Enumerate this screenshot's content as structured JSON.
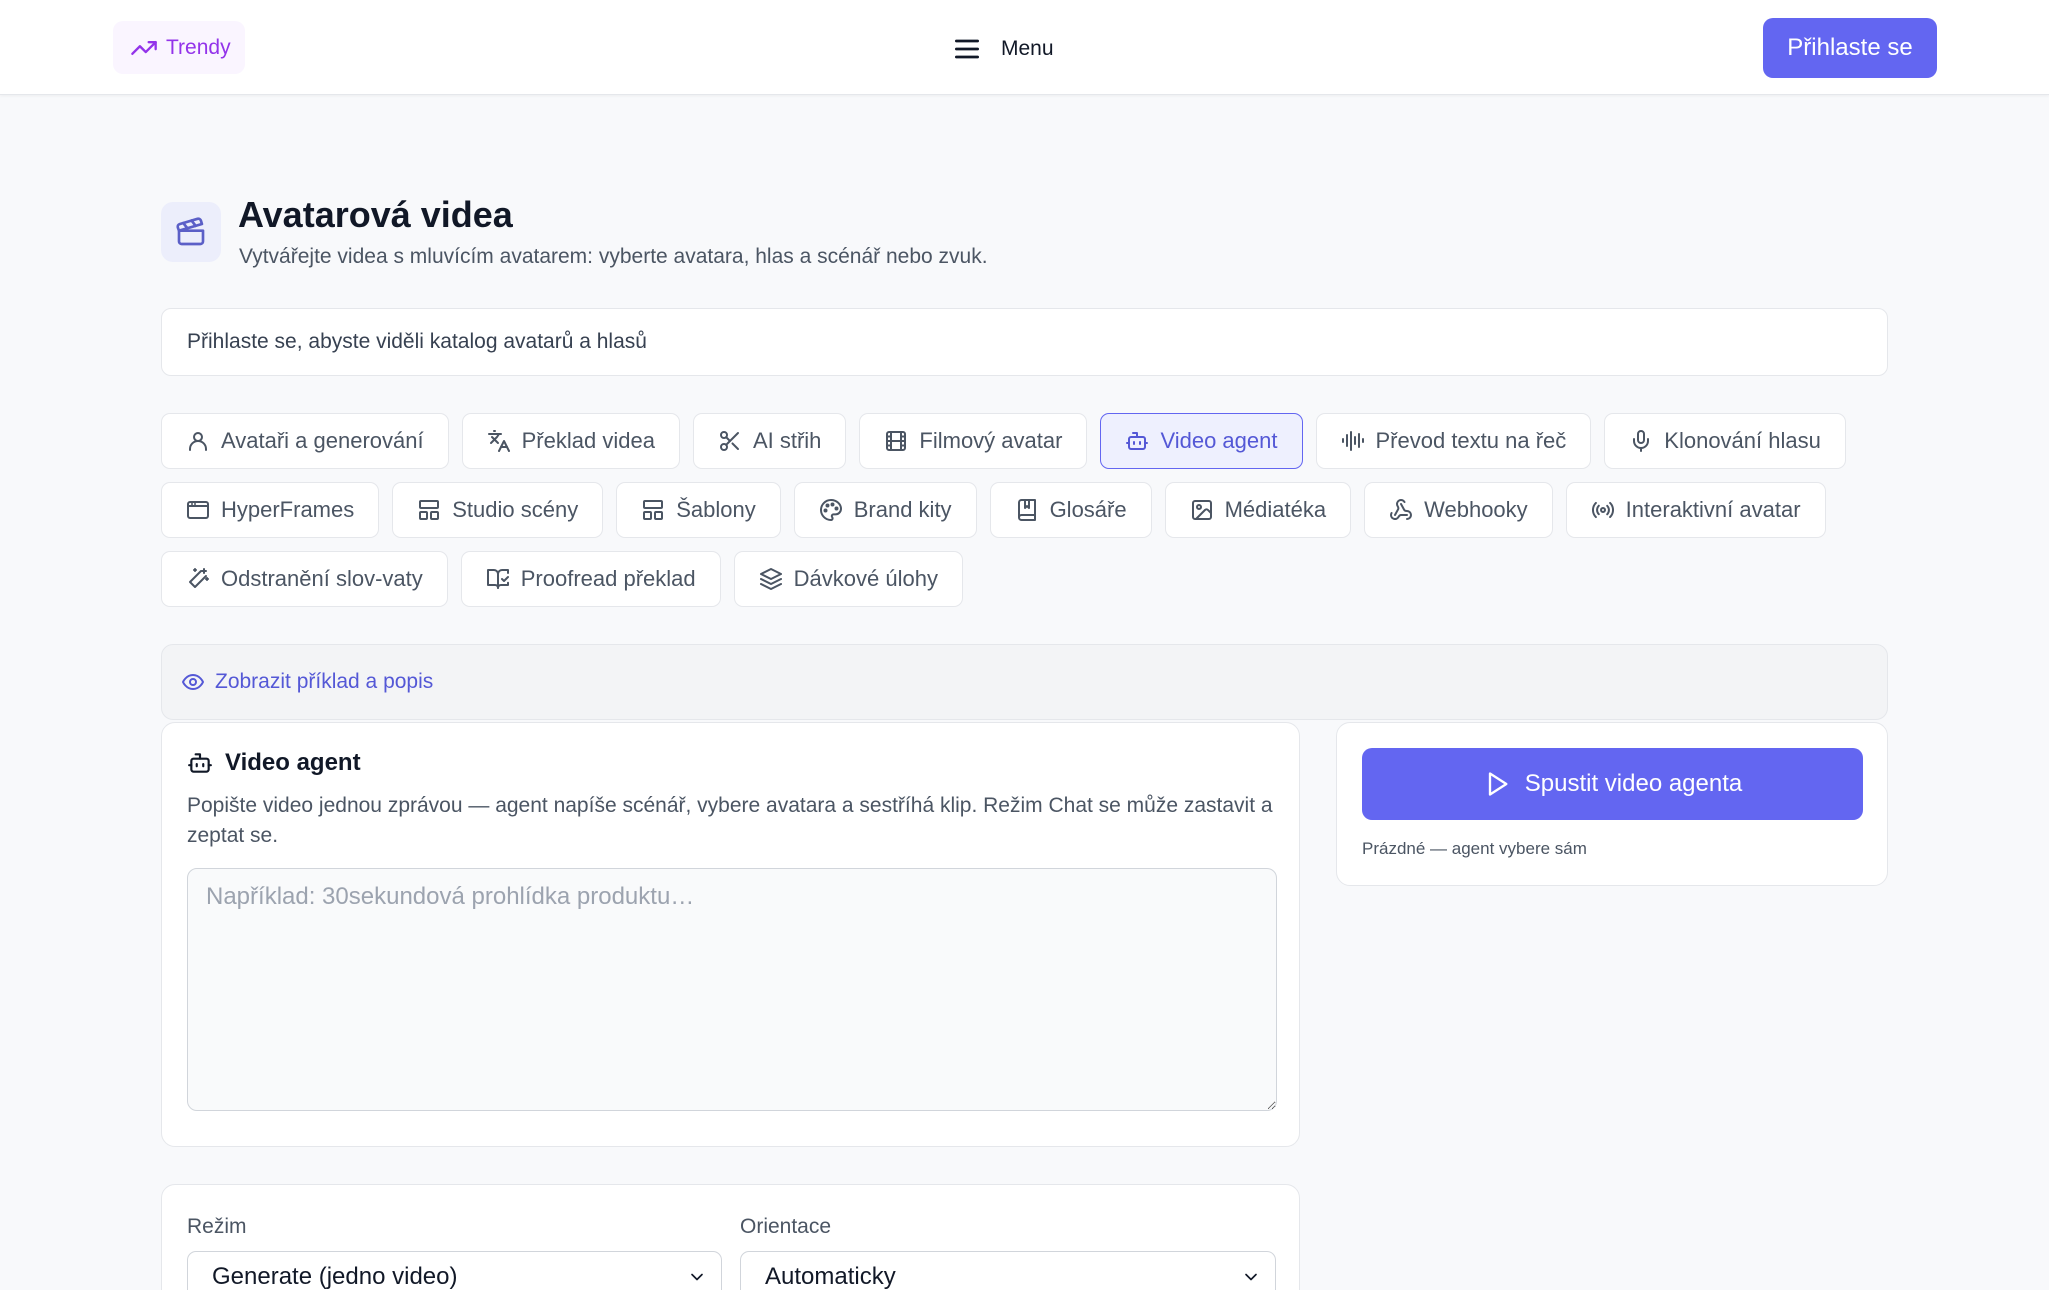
{
  "header": {
    "trendy_label": "Trendy",
    "menu_label": "Menu",
    "login_label": "Přihlaste se"
  },
  "page": {
    "title": "Avatarová videa",
    "subtitle": "Vytvářejte videa s mluvícím avatarem: vyberte avatara, hlas a scénář nebo zvuk.",
    "login_notice": "Přihlaste se, abyste viděli katalog avatarů a hlasů"
  },
  "tabs": [
    {
      "label": "Avatаři a generování",
      "icon": "user-icon"
    },
    {
      "label": "Překlad videa",
      "icon": "translate-icon"
    },
    {
      "label": "AI střih",
      "icon": "scissors-icon"
    },
    {
      "label": "Filmový avatar",
      "icon": "film-icon"
    },
    {
      "label": "Video agent",
      "icon": "bot-icon",
      "active": true
    },
    {
      "label": "Převod textu na řeč",
      "icon": "audio-waveform-icon"
    },
    {
      "label": "Klonování hlasu",
      "icon": "microphone-icon"
    },
    {
      "label": "HyperFrames",
      "icon": "app-window-icon"
    },
    {
      "label": "Studio scény",
      "icon": "layout-icon"
    },
    {
      "label": "Šablony",
      "icon": "template-icon"
    },
    {
      "label": "Brand kity",
      "icon": "palette-icon"
    },
    {
      "label": "Glosáře",
      "icon": "book-icon"
    },
    {
      "label": "Médiatéka",
      "icon": "image-icon"
    },
    {
      "label": "Webhooky",
      "icon": "webhook-icon"
    },
    {
      "label": "Interaktivní avatar",
      "icon": "radio-icon"
    },
    {
      "label": "Odstranění slov-vaty",
      "icon": "magic-wand-icon"
    },
    {
      "label": "Proofread překlad",
      "icon": "book-open-check-icon"
    },
    {
      "label": "Dávkové úlohy",
      "icon": "layers-icon"
    }
  ],
  "example_toggle": "Zobrazit příklad a popis",
  "agent": {
    "title": "Video agent",
    "description": "Popište video jednou zprávou — agent napíše scénář, vybere avatara a sestříhá klip. Režim Chat se může zastavit a zeptat se.",
    "prompt_placeholder": "Například: 30sekundová prohlídka produktu…",
    "run_label": "Spustit video agenta",
    "run_hint": "Prázdné — agent vybere sám"
  },
  "settings": {
    "mode_label": "Režim",
    "mode_value": "Generate (jedno video)",
    "orientation_label": "Orientace",
    "orientation_value": "Automaticky"
  },
  "colors": {
    "accent": "#6366f1",
    "trendy": "#9333ea"
  }
}
